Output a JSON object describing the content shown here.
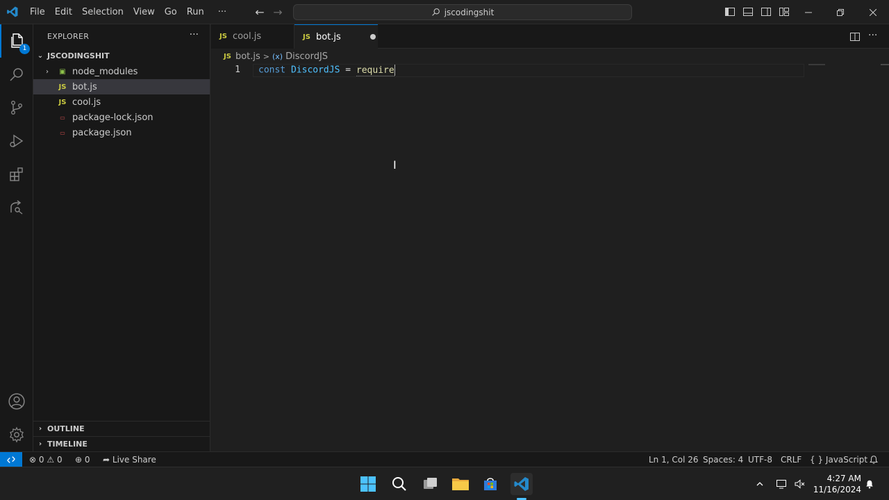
{
  "menu": [
    "File",
    "Edit",
    "Selection",
    "View",
    "Go",
    "Run",
    "···"
  ],
  "search": {
    "text": "jscodingshit"
  },
  "activity_bar": {
    "explorer_badge": "1"
  },
  "sidebar": {
    "title": "EXPLORER",
    "more": "···",
    "root_folder": "JSCODINGSHIT",
    "items": [
      {
        "label": "node_modules",
        "icon": "folder-node-icon",
        "kind": "folder"
      },
      {
        "label": "bot.js",
        "icon": "js-file-icon",
        "kind": "js",
        "selected": true
      },
      {
        "label": "cool.js",
        "icon": "js-file-icon",
        "kind": "js"
      },
      {
        "label": "package-lock.json",
        "icon": "json-file-icon",
        "kind": "json"
      },
      {
        "label": "package.json",
        "icon": "json-file-icon",
        "kind": "json"
      }
    ],
    "outline": "OUTLINE",
    "timeline": "TIMELINE"
  },
  "tabs": [
    {
      "label": "cool.js",
      "tag": "JS",
      "active": false
    },
    {
      "label": "bot.js",
      "tag": "JS",
      "active": true,
      "dirty": true
    }
  ],
  "breadcrumbs": {
    "tag": "JS",
    "file": "bot.js",
    "separator": ">",
    "symbol": "DiscordJS"
  },
  "editor": {
    "line_number": "1",
    "tokens": {
      "kw": "const",
      "var": "DiscordJS",
      "op": "=",
      "fn": "require"
    }
  },
  "statusbar": {
    "errors": "0",
    "warnings": "0",
    "ports": "0",
    "live_share": "Live Share",
    "position": "Ln 1, Col 26",
    "spaces": "Spaces: 4",
    "encoding": "UTF-8",
    "eol": "CRLF",
    "language": "JavaScript"
  },
  "taskbar": {
    "time": "4:27 AM",
    "date": "11/16/2024"
  },
  "colors": {
    "accent": "#0078d4",
    "js_yellow": "#cbcb41",
    "keyword": "#569cd6",
    "variable": "#4fc1ff",
    "function": "#dcdcaa"
  }
}
